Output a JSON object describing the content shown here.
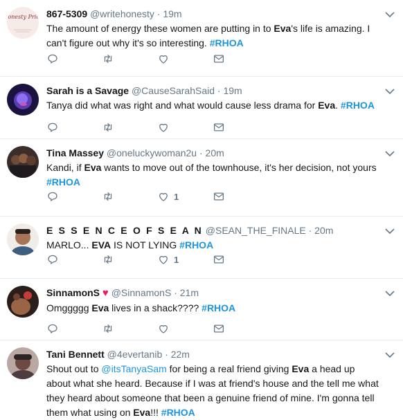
{
  "tweets": [
    {
      "display_name": "867-5309",
      "handle": "@writehonesty",
      "time": "19m",
      "avatar_label": "Honesty Price",
      "text_html": "The amount of energy these women are putting in to <b>Eva</b>'s life is amazing. I can't figure out why it's so interesting. <span class=\"hashtag\">#RHOA</span>",
      "likes": "",
      "avatar_color": "#f4e3e3"
    },
    {
      "display_name": "Sarah is a Savage",
      "handle": "@CauseSarahSaid",
      "time": "19m",
      "text_html": "Tanya did what was right and what would cause less drama for <b>Eva</b>. <span class=\"hashtag\">#RHOA</span>",
      "likes": "",
      "avatar_color": "#2a1f5e"
    },
    {
      "display_name": "Tina Massey",
      "handle": "@oneluckywoman2u",
      "time": "20m",
      "text_html": "Kandi, if <b>Eva</b> wants to move out of the townhouse, it's her decision, not yours <span class=\"hashtag\">#RHOA</span>",
      "likes": "1",
      "avatar_color": "#4a3b36"
    },
    {
      "display_name": "E S S E N C E O F S E A N",
      "handle": "@SEAN_THE_FINALE",
      "time": "20m",
      "text_html": "MARLO... <b>EVA</b> IS NOT LYING <span class=\"hashtag\">#RHOA</span>",
      "likes": "1",
      "avatar_color": "#c79a7a"
    },
    {
      "display_name": "SinnamonS",
      "emoji": "♥",
      "handle": "@SinnamonS",
      "time": "21m",
      "text_html": "Omggggg <b>Eva</b> lives in a shack???? <span class=\"hashtag\">#RHOA</span>",
      "likes": "",
      "avatar_color": "#6b3a2a"
    },
    {
      "display_name": "Tani Bennett",
      "handle": "@4evertanib",
      "time": "22m",
      "text_html": "Shout out to <span class=\"mention\">@itsTanyaSam</span> for being a real friend giving <b>Eva</b> a head up about what she heard. Because if I was at friend's house and the tell me what they heard about someone that been a genuine friend of mine. I'm gonna tell them what using on <b>Eva</b>!!! <span class=\"hashtag\">#RHOA</span>",
      "likes": "",
      "avatar_color": "#8a6f6a"
    }
  ],
  "colors": {
    "accent": "#1b95e0",
    "icon": "#657786",
    "divider": "#e6ecf0"
  }
}
